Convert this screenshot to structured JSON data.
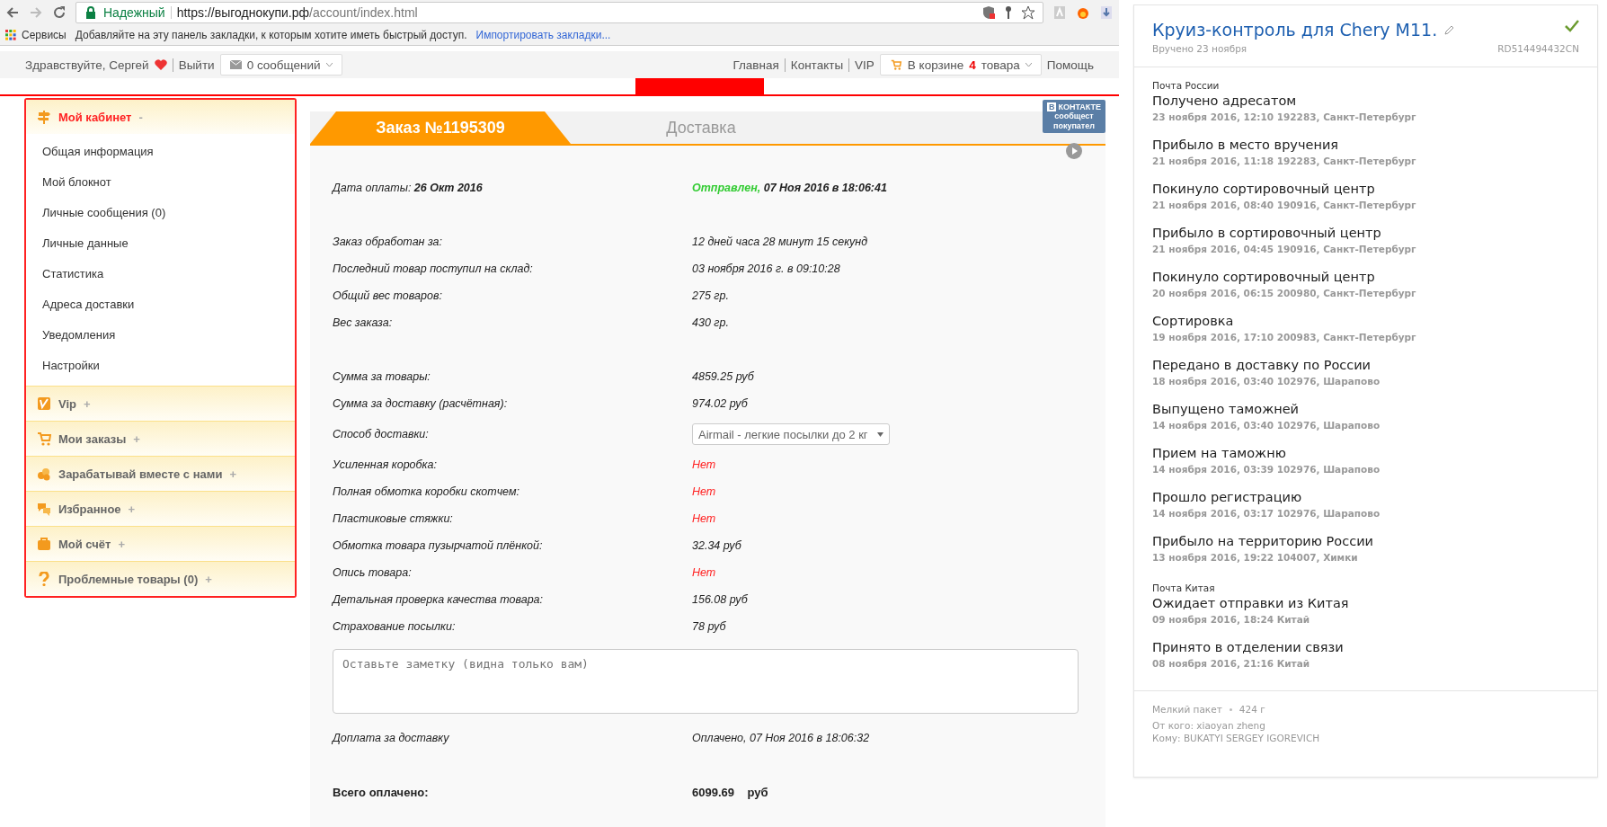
{
  "browser": {
    "secure_label": "Надежный",
    "url_host": "https://выгоднокупи.рф",
    "url_path": "/account/index.html",
    "apps_label": "Сервисы",
    "bookmarks_hint": "Добавляйте на эту панель закладки, к которым хотите иметь быстрый доступ.",
    "import_link": "Импортировать закладки..."
  },
  "header": {
    "greeting": "Здравствуйте, Сергей",
    "logout": "Выйти",
    "messages": "0 сообщений",
    "links": [
      "Главная",
      "Контакты",
      "VIP"
    ],
    "cart": {
      "prefix": "В корзине",
      "count": "4",
      "suffix": "товара"
    },
    "help": "Помощь"
  },
  "sidebar": [
    {
      "label": "Мой кабинет",
      "toggle": "-",
      "expanded": true,
      "kind": "signpost",
      "items": [
        "Общая информация",
        "Мой блокнот",
        "Личные сообщения (0)",
        "Личные данные",
        "Статистика",
        "Адреса доставки",
        "Уведомления",
        "Настройки"
      ]
    },
    {
      "label": "Vip",
      "toggle": "+",
      "expanded": false,
      "kind": "vip"
    },
    {
      "label": "Мои заказы",
      "toggle": "+",
      "expanded": false,
      "kind": "cart"
    },
    {
      "label": "Зарабатывай вместе с нами",
      "toggle": "+",
      "expanded": false,
      "kind": "coins"
    },
    {
      "label": "Избранное",
      "toggle": "+",
      "expanded": false,
      "kind": "chat"
    },
    {
      "label": "Мой счёт",
      "toggle": "+",
      "expanded": false,
      "kind": "briefcase"
    },
    {
      "label": "Проблемные товары (0)",
      "toggle": "+",
      "expanded": false,
      "kind": "question"
    }
  ],
  "order": {
    "tabs": [
      {
        "label": "Заказ №1195309",
        "selected": true
      },
      {
        "label": "Доставка",
        "selected": false
      }
    ],
    "payment_date": {
      "label": "Дата оплаты:",
      "value": "26 Окт 2016"
    },
    "status": {
      "state": "Отправлен,",
      "datetime": "07 Ноя 2016 в 18:06:41"
    },
    "groups": [
      [
        {
          "label": "Заказ обработан за:",
          "value": "12 дней часа 28 минут 15 секунд",
          "kind": "text"
        },
        {
          "label": "Последний товар поступил на склад:",
          "value": "03 ноября 2016 г. в 09:10:28",
          "kind": "text"
        },
        {
          "label": "Общий вес товаров:",
          "value": "275 гр.",
          "kind": "text"
        },
        {
          "label": "Вес заказа:",
          "value": "430 гр.",
          "kind": "text"
        }
      ],
      [
        {
          "label": "Сумма за товары:",
          "value": "4859.25 руб",
          "kind": "text"
        },
        {
          "label": "Сумма за доставку (расчётная):",
          "value": "974.02 руб",
          "kind": "text"
        },
        {
          "label": "Способ доставки:",
          "value": "Airmail - легкие посылки до 2 кг",
          "kind": "select"
        },
        {
          "label": "Усиленная коробка:",
          "value": "Нет",
          "kind": "negative"
        },
        {
          "label": "Полная обмотка коробки скотчем:",
          "value": "Нет",
          "kind": "negative"
        },
        {
          "label": "Пластиковые стяжки:",
          "value": "Нет",
          "kind": "negative"
        },
        {
          "label": "Обмотка товара пузырчатой плёнкой:",
          "value": "32.34  руб",
          "kind": "text"
        },
        {
          "label": "Опись товара:",
          "value": "Нет",
          "kind": "negative"
        },
        {
          "label": "Детальная проверка качества товара:",
          "value": "156.08  руб",
          "kind": "text"
        },
        {
          "label": "Страхование посылки:",
          "value": "78 руб",
          "kind": "text"
        }
      ]
    ],
    "note": {
      "placeholder": "Оставьте заметку (видна только вам)"
    },
    "extra_payment": {
      "label": "Доплата за доставку",
      "value": "Оплачено, 07 Ноя 2016 в 18:06:32"
    },
    "total": {
      "label": "Всего оплачено:",
      "amount": "6099.69",
      "currency": "руб"
    }
  },
  "vk_badge": {
    "logo": "В",
    "title": "КОНТАКТЕ",
    "lines": [
      "сообщест",
      "покупател"
    ]
  },
  "tracking": {
    "title": "Круиз-контроль для Chery M11.",
    "delivered": true,
    "delivered_label": "Вручено 23 ноября",
    "track_number": "RD514494432CN",
    "carriers": [
      {
        "name": "Почта России",
        "events": [
          {
            "status": "Получено адресатом",
            "detail": "23 ноября 2016, 12:10 192283, Санкт-Петербург"
          },
          {
            "status": "Прибыло в место вручения",
            "detail": "21 ноября 2016, 11:18 192283, Санкт-Петербург"
          },
          {
            "status": "Покинуло сортировочный центр",
            "detail": "21 ноября 2016, 08:40 190916, Санкт-Петербург"
          },
          {
            "status": "Прибыло в сортировочный центр",
            "detail": "21 ноября 2016, 04:45 190916, Санкт-Петербург"
          },
          {
            "status": "Покинуло сортировочный центр",
            "detail": "20 ноября 2016, 06:15 200980, Санкт-Петербург"
          },
          {
            "status": "Сортировка",
            "detail": "19 ноября 2016, 17:10 200983, Санкт-Петербург"
          },
          {
            "status": "Передано в доставку по России",
            "detail": "18 ноября 2016, 03:40 102976, Шарапово"
          },
          {
            "status": "Выпущено таможней",
            "detail": "14 ноября 2016, 03:40 102976, Шарапово"
          },
          {
            "status": "Прием на таможню",
            "detail": "14 ноября 2016, 03:39 102976, Шарапово"
          },
          {
            "status": "Прошло регистрацию",
            "detail": "14 ноября 2016, 03:17 102976, Шарапово"
          },
          {
            "status": "Прибыло на территорию России",
            "detail": "13 ноября 2016, 19:22 104007, Химки"
          }
        ]
      },
      {
        "name": "Почта Китая",
        "events": [
          {
            "status": "Ожидает отправки из Китая",
            "detail": "09 ноября 2016, 18:24 Китай"
          },
          {
            "status": "Принято в отделении связи",
            "detail": "08 ноября 2016, 21:16 Китай"
          }
        ]
      }
    ],
    "package_type": "Мелкий пакет",
    "weight": "424 г",
    "sender": "От кого: xiaoyan zheng",
    "recipient": "Кому: BUKATYI SERGEY IGOREVICH"
  }
}
